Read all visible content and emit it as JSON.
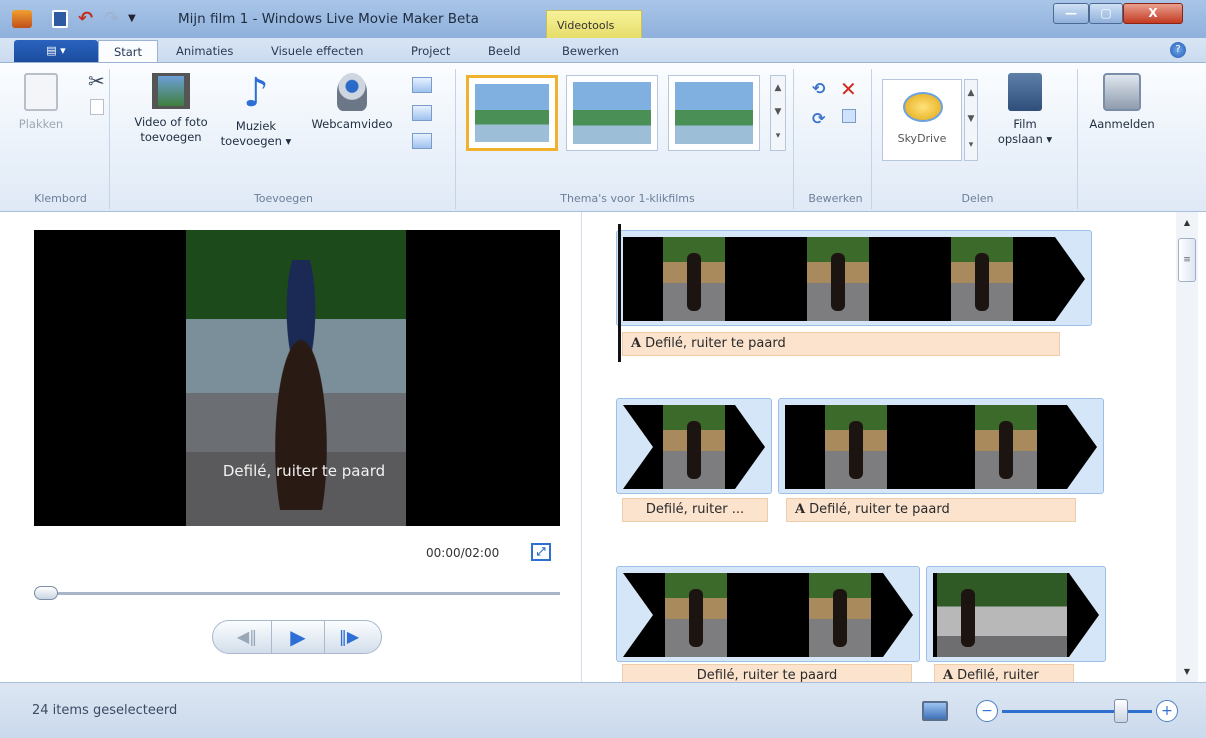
{
  "window": {
    "title": "Mijn film 1 - Windows Live Movie Maker Beta",
    "context_tab": "Videotools",
    "minimize": "—",
    "maximize": "▢",
    "close": "X"
  },
  "tabs": [
    {
      "label": "Start",
      "selected": true
    },
    {
      "label": "Animaties"
    },
    {
      "label": "Visuele effecten"
    },
    {
      "label": "Project"
    },
    {
      "label": "Beeld"
    },
    {
      "label": "Bewerken"
    }
  ],
  "ribbon": {
    "klembord": {
      "label": "Klembord",
      "paste": "Plakken"
    },
    "toevoegen": {
      "label": "Toevoegen",
      "video_line1": "Video of foto",
      "video_line2": "toevoegen",
      "music_line1": "Muziek",
      "music_line2": "toevoegen ▾",
      "webcam": "Webcamvideo"
    },
    "themes": {
      "label": "Thema's voor 1-klikfilms"
    },
    "bewerken": {
      "label": "Bewerken"
    },
    "delen": {
      "label": "Delen",
      "skydrive": "SkyDrive",
      "film_line1": "Film",
      "film_line2": "opslaan ▾"
    },
    "signin": {
      "label": "Aanmelden"
    }
  },
  "preview": {
    "caption": "Defilé, ruiter te paard",
    "timecode": "00:00/02:00",
    "progress": 0
  },
  "storyboard": {
    "captions": [
      "Defilé, ruiter te paard",
      "Defilé, ruiter ...",
      "Defilé, ruiter te paard",
      "Defilé, ruiter te paard",
      "Defilé, ruiter"
    ]
  },
  "status": {
    "text": "24 items geselecteerd"
  },
  "colors": {
    "accent": "#2f6fd0",
    "caption_bg": "#fbe3cd",
    "context_tab": "#f0ea8a"
  },
  "icons": [
    "app-icon",
    "save-icon",
    "undo-icon",
    "redo-icon",
    "cut-icon",
    "copy-icon",
    "webcam-icon",
    "music-icon",
    "skydrive-icon",
    "help-icon"
  ]
}
